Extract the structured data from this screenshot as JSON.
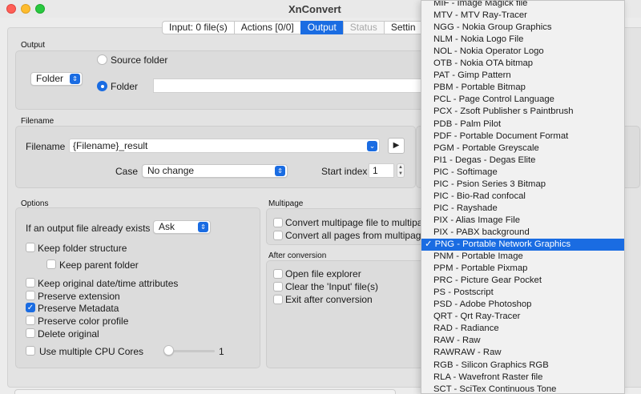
{
  "window": {
    "title": "XnConvert"
  },
  "tabs": [
    "Input: 0 file(s)",
    "Actions [0/0]",
    "Output",
    "Status",
    "Settin"
  ],
  "output": {
    "section_label": "Output",
    "dest_popup": "Folder",
    "radio_source": "Source folder",
    "radio_folder": "Folder",
    "folder_path": ""
  },
  "filename": {
    "section_label": "Filename",
    "label": "Filename",
    "value": "{Filename}_result",
    "case_label": "Case",
    "case_value": "No change",
    "start_index_label": "Start index",
    "start_index_value": "1"
  },
  "options": {
    "section_label": "Options",
    "if_exists_label": "If an output file already exists",
    "if_exists_value": "Ask",
    "keep_folder": "Keep folder structure",
    "keep_parent": "Keep parent folder",
    "keep_dates": "Keep original date/time attributes",
    "preserve_ext": "Preserve extension",
    "preserve_meta": "Preserve Metadata",
    "preserve_color": "Preserve color profile",
    "delete_original": "Delete original",
    "multi_cpu": "Use multiple CPU Cores",
    "cpu_value": "1",
    "cpu_level": 0
  },
  "multipage": {
    "section_label": "Multipage",
    "convert_multi": "Convert multipage file to multipag",
    "convert_all": "Convert all pages from multipage"
  },
  "after": {
    "section_label": "After conversion",
    "open_explorer": "Open file explorer",
    "clear_input": "Clear the 'Input' file(s)",
    "exit_after": "Exit after conversion"
  },
  "format_menu": {
    "selected_index": 20,
    "items": [
      "MIF - Image Magick file",
      "MTV - MTV Ray-Tracer",
      "NGG - Nokia Group Graphics",
      "NLM - Nokia Logo File",
      "NOL - Nokia Operator Logo",
      "OTB - Nokia OTA bitmap",
      "PAT - Gimp Pattern",
      "PBM - Portable Bitmap",
      "PCL - Page Control Language",
      "PCX - Zsoft Publisher s Paintbrush",
      "PDB - Palm Pilot",
      "PDF - Portable Document Format",
      "PGM - Portable Greyscale",
      "PI1 - Degas - Degas Elite",
      "PIC - Softimage",
      "PIC - Psion Series 3 Bitmap",
      "PIC - Bio-Rad confocal",
      "PIC - Rayshade",
      "PIX - Alias Image File",
      "PIX - PABX background",
      "PNG - Portable Network Graphics",
      "PNM - Portable Image",
      "PPM - Portable Pixmap",
      "PRC - Picture Gear Pocket",
      "PS - Postscript",
      "PSD - Adobe Photoshop",
      "QRT - Qrt Ray-Tracer",
      "RAD - Radiance",
      "RAW - Raw",
      "RAWRAW - Raw",
      "RGB - Silicon Graphics RGB",
      "RLA - Wavefront Raster file",
      "SCT - SciTex Continuous Tone"
    ]
  },
  "colors": {
    "accent": "#1a6ce2"
  }
}
